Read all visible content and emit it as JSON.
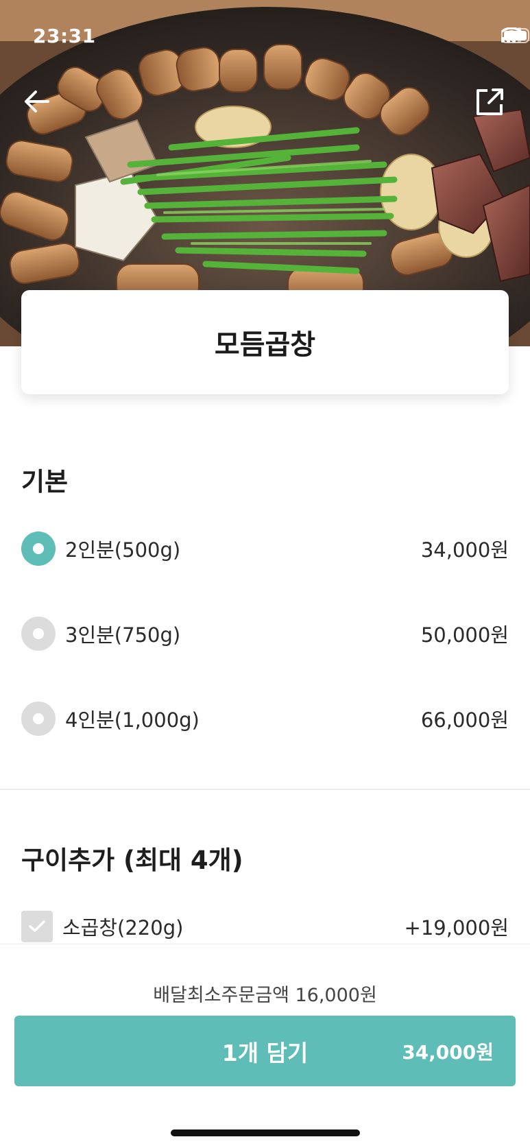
{
  "status_bar": {
    "time": "23:31",
    "icons": [
      "signal-icon",
      "wifi-icon",
      "battery-icon"
    ]
  },
  "nav": {
    "back_icon": "back-arrow-icon",
    "share_icon": "share-icon"
  },
  "menu": {
    "title": "모듬곱창"
  },
  "basic_section": {
    "title": "기본",
    "options": [
      {
        "label": "2인분(500g)",
        "price": "34,000원",
        "selected": true
      },
      {
        "label": "3인분(750g)",
        "price": "50,000원",
        "selected": false
      },
      {
        "label": "4인분(1,000g)",
        "price": "66,000원",
        "selected": false
      }
    ]
  },
  "extra_section": {
    "title": "구이추가 (최대 4개)",
    "options": [
      {
        "label": "소곱창(220g)",
        "price": "+19,000원",
        "checked": false
      }
    ]
  },
  "bottom": {
    "min_order": "배달최소주문금액 16,000원",
    "cart_label": "1개 담기",
    "cart_price": "34,000원"
  },
  "colors": {
    "accent": "#5fbdb8",
    "radio_off": "#dcdcdc",
    "text": "#222222"
  }
}
